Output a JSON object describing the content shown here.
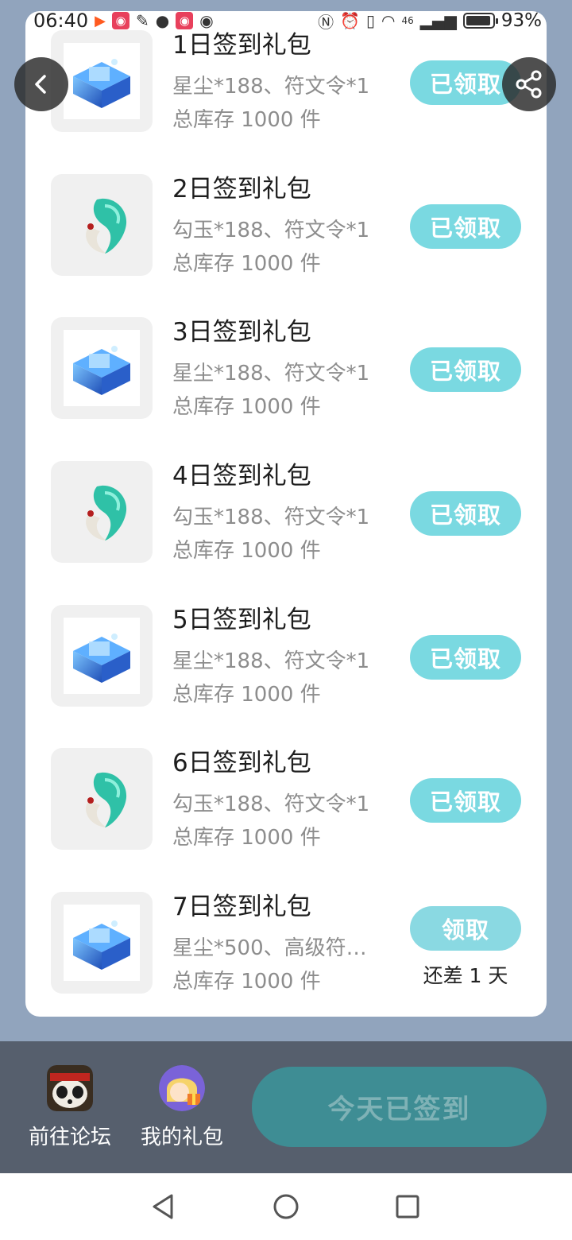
{
  "status": {
    "time": "06:40",
    "battery": "93%",
    "battery_level": 0.93,
    "network": "46"
  },
  "gifts": [
    {
      "title": "1日签到礼包",
      "desc": "星尘*188、符文令*1",
      "stock": "总库存 1000 件",
      "button": "已领取",
      "icon": "blue-chest-icon"
    },
    {
      "title": "2日签到礼包",
      "desc": "勾玉*188、符文令*1",
      "stock": "总库存 1000 件",
      "button": "已领取",
      "icon": "jade-magatama-icon"
    },
    {
      "title": "3日签到礼包",
      "desc": "星尘*188、符文令*1",
      "stock": "总库存 1000 件",
      "button": "已领取",
      "icon": "blue-chest-icon"
    },
    {
      "title": "4日签到礼包",
      "desc": "勾玉*188、符文令*1",
      "stock": "总库存 1000 件",
      "button": "已领取",
      "icon": "jade-magatama-icon"
    },
    {
      "title": "5日签到礼包",
      "desc": "星尘*188、符文令*1",
      "stock": "总库存 1000 件",
      "button": "已领取",
      "icon": "blue-chest-icon"
    },
    {
      "title": "6日签到礼包",
      "desc": "勾玉*188、符文令*1",
      "stock": "总库存 1000 件",
      "button": "已领取",
      "icon": "jade-magatama-icon"
    },
    {
      "title": "7日签到礼包",
      "desc": "星尘*500、高级符…",
      "stock": "总库存 1000 件",
      "button": "领取",
      "remain": "还差 1 天",
      "icon": "blue-chest-icon"
    }
  ],
  "bottom": {
    "forum_label": "前往论坛",
    "mygift_label": "我的礼包",
    "signin_label": "今天已签到"
  },
  "colors": {
    "claimed_button": "#7ad9e1",
    "signin_button": "#3e8d94",
    "bottom_bar": "#565f6d",
    "backdrop": "#91a4bd"
  }
}
